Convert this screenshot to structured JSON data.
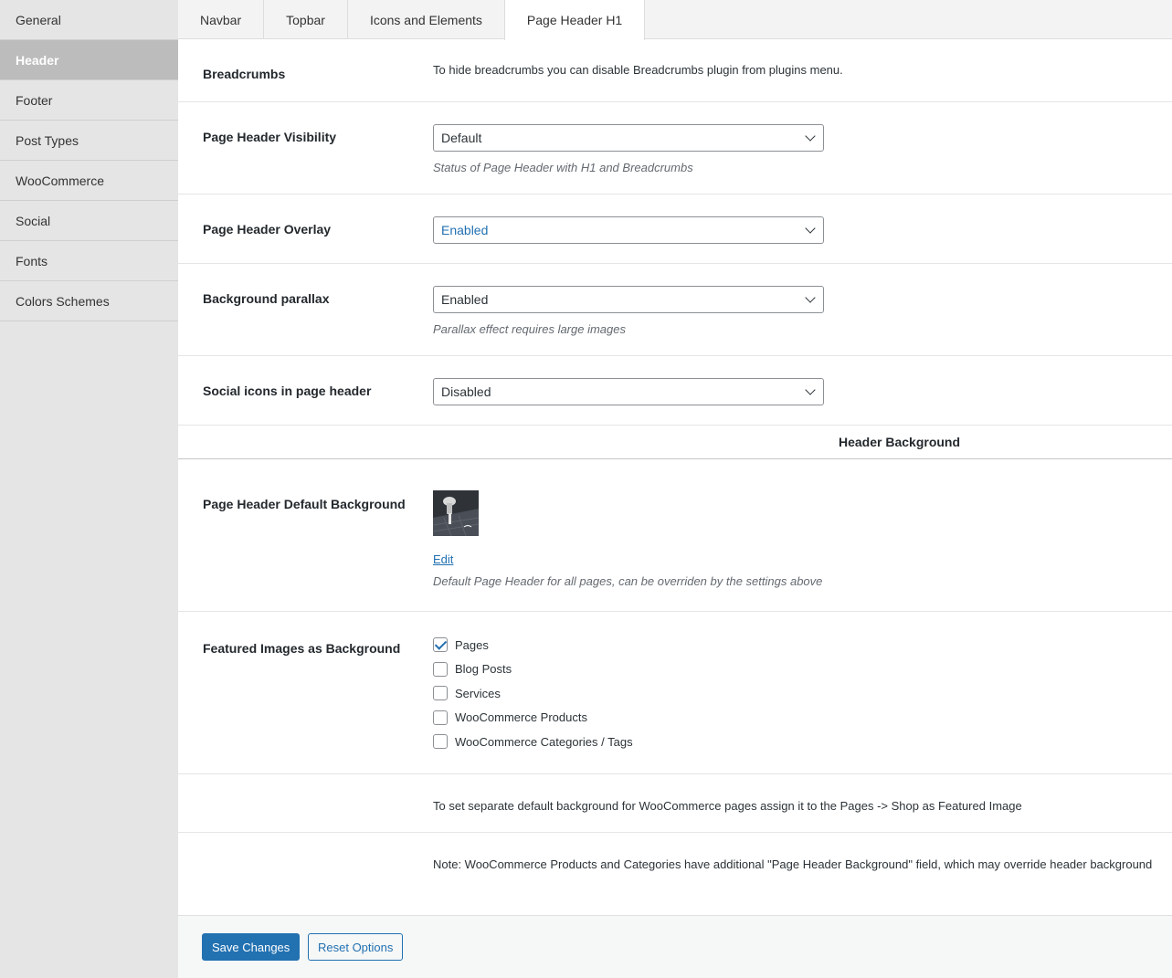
{
  "sidebar": {
    "items": [
      {
        "label": "General"
      },
      {
        "label": "Header",
        "active": true
      },
      {
        "label": "Footer"
      },
      {
        "label": "Post Types"
      },
      {
        "label": "WooCommerce"
      },
      {
        "label": "Social"
      },
      {
        "label": "Fonts"
      },
      {
        "label": "Colors Schemes"
      }
    ]
  },
  "tabs": [
    {
      "label": "Navbar"
    },
    {
      "label": "Topbar"
    },
    {
      "label": "Icons and Elements"
    },
    {
      "label": "Page Header H1",
      "active": true
    }
  ],
  "settings": {
    "breadcrumbs": {
      "label": "Breadcrumbs",
      "text": "To hide breadcrumbs you can disable Breadcrumbs plugin from plugins menu."
    },
    "visibility": {
      "label": "Page Header Visibility",
      "value": "Default",
      "description": "Status of Page Header with H1 and Breadcrumbs"
    },
    "overlay": {
      "label": "Page Header Overlay",
      "value": "Enabled"
    },
    "parallax": {
      "label": "Background parallax",
      "value": "Enabled",
      "description": "Parallax effect requires large images"
    },
    "social": {
      "label": "Social icons in page header",
      "value": "Disabled"
    },
    "section_title": "Header Background",
    "default_bg": {
      "label": "Page Header Default Background",
      "edit": "Edit",
      "description": "Default Page Header for all pages, can be overriden by the settings above"
    },
    "featured": {
      "label": "Featured Images as Background",
      "options": [
        {
          "label": "Pages",
          "checked": true
        },
        {
          "label": "Blog Posts",
          "checked": false
        },
        {
          "label": "Services",
          "checked": false
        },
        {
          "label": "WooCommerce Products",
          "checked": false
        },
        {
          "label": "WooCommerce Categories / Tags",
          "checked": false
        }
      ]
    },
    "woo_note": "To set separate default background for WooCommerce pages assign it to the Pages -> Shop as Featured Image",
    "note": "Note: WooCommerce Products and Categories have additional \"Page Header Background\" field, which may override header background"
  },
  "footer": {
    "save": "Save Changes",
    "reset": "Reset Options"
  },
  "colors": {
    "primary": "#2271b1",
    "sidebar_bg": "#e5e5e5",
    "sidebar_active": "#bcbcbc"
  }
}
